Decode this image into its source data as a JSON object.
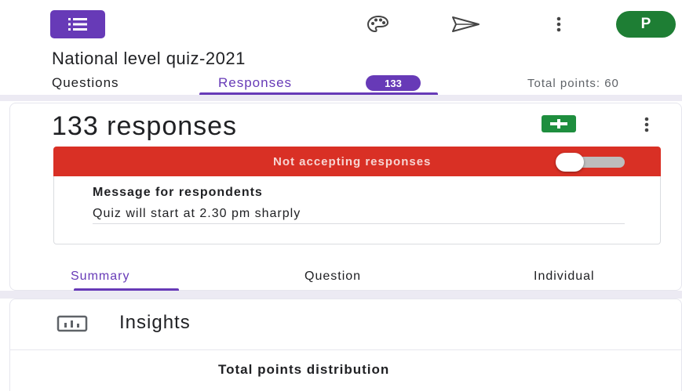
{
  "header": {
    "logo_icon": "google-forms-icon",
    "palette_icon": "palette-icon",
    "send_icon": "send-icon",
    "more_icon": "more-vert-icon",
    "avatar_letter": "P",
    "form_title": "National level quiz-2021"
  },
  "tabs": {
    "questions_label": "Questions",
    "responses_label": "Responses",
    "responses_count": "133",
    "total_points": "Total points: 60"
  },
  "responses": {
    "count_label": "133 responses",
    "sheets_icon": "google-sheets-icon",
    "more_icon": "more-vert-icon",
    "accepting_label": "Not accepting responses",
    "accepting": false,
    "message_heading": "Message for respondents",
    "message_text": "Quiz will start at 2.30 pm sharply"
  },
  "subtabs": {
    "summary": "Summary",
    "question": "Question",
    "individual": "Individual"
  },
  "insights": {
    "icon": "insights-chart-icon",
    "title": "Insights",
    "distribution_title": "Total points distribution"
  },
  "colors": {
    "accent": "#673ab7",
    "banner_red": "#d93025",
    "avatar_green": "#1e7e34",
    "sheets_green": "#1e8e3e"
  }
}
